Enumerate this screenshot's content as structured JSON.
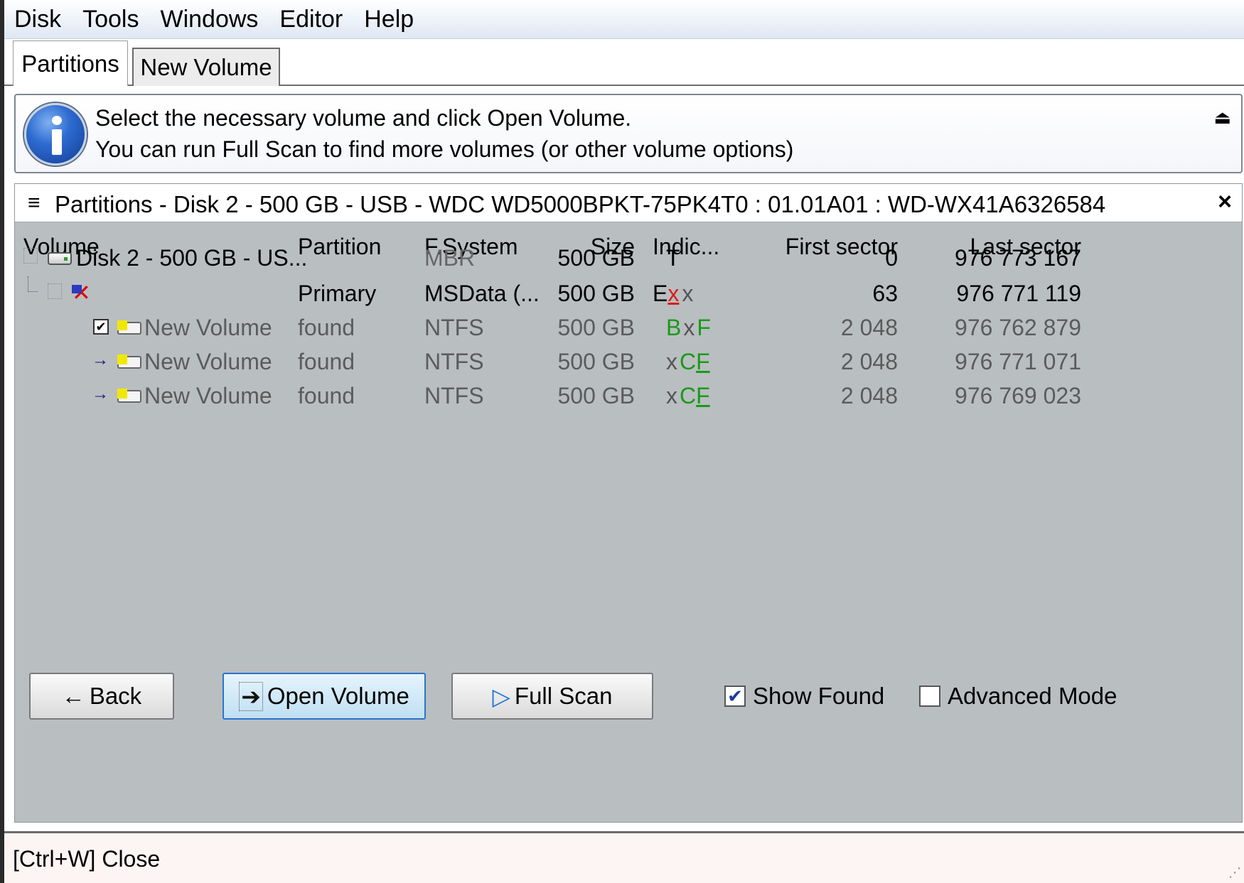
{
  "menu": [
    "Disk",
    "Tools",
    "Windows",
    "Editor",
    "Help"
  ],
  "tabs": {
    "active": "Partitions",
    "inactive": "New Volume"
  },
  "info": {
    "line1": "Select the necessary volume and click Open Volume.",
    "line2": "You can run Full Scan to find more volumes (or other volume options)",
    "collapse_glyph": "⏏"
  },
  "panel": {
    "title": "Partitions - Disk 2 - 500 GB - USB - WDC WD5000BPKT-75PK4T0 : 01.01A01 : WD-WX41A6326584",
    "close_glyph": "×",
    "menu_glyph": "≡"
  },
  "columns": {
    "volume": "Volume",
    "partition": "Partition",
    "fsystem": "F.System",
    "size": "Size",
    "indicators": "Indic...",
    "first_sector": "First sector",
    "last_sector": "Last sector"
  },
  "rows": [
    {
      "volume": "Disk 2 - 500 GB - US...",
      "partition": "",
      "fsystem": "MBR",
      "size": "500 GB",
      "ind": [
        "T",
        "",
        ""
      ],
      "first": "0",
      "last": "976 773 167"
    },
    {
      "volume": "",
      "partition": "Primary",
      "fsystem": "MSData (...",
      "size": "500 GB",
      "ind": [
        "E",
        "x",
        "x"
      ],
      "first": "63",
      "last": "976 771 119"
    },
    {
      "volume": "New Volume",
      "partition": "found",
      "fsystem": "NTFS",
      "size": "500 GB",
      "ind": [
        "B",
        "x",
        "F"
      ],
      "first": "2 048",
      "last": "976 762 879",
      "checked": "✔"
    },
    {
      "volume": "New Volume",
      "partition": "found",
      "fsystem": "NTFS",
      "size": "500 GB",
      "ind": [
        "x",
        "C",
        "F"
      ],
      "first": "2 048",
      "last": "976 771 071"
    },
    {
      "volume": "New Volume",
      "partition": "found",
      "fsystem": "NTFS",
      "size": "500 GB",
      "ind": [
        "x",
        "C",
        "F"
      ],
      "first": "2 048",
      "last": "976 769 023"
    }
  ],
  "buttons": {
    "back": "Back",
    "back_glyph": "←",
    "open": "Open Volume",
    "open_glyph": "➔",
    "scan": "Full Scan",
    "scan_glyph": "▷"
  },
  "checkboxes": {
    "show_found": "Show Found",
    "show_found_checked": "✔",
    "advanced_mode": "Advanced Mode"
  },
  "status": {
    "close_hint": "[Ctrl+W] Close",
    "grip_glyph": "⋰"
  },
  "colors": {
    "indicator_green": "#1a9a1a",
    "indicator_red": "#dc1c1c",
    "panel_bg": "#b9bec1",
    "open_button_border": "#2d73c9"
  }
}
